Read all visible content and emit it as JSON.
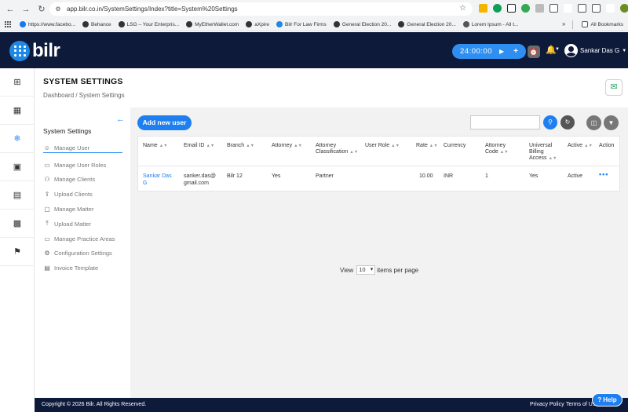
{
  "browser": {
    "url": "app.bilr.co.in/SystemSettings/Index?title=System%20Settings",
    "bookmarks": [
      {
        "label": "https://www.facebo...",
        "color": "#1877f2"
      },
      {
        "label": "Behance",
        "color": "#333333"
      },
      {
        "label": "LSG – Your Enterpris...",
        "color": "#333333"
      },
      {
        "label": "MyEtherWallet.com",
        "color": "#333333"
      },
      {
        "label": "aXpire",
        "color": "#333333"
      },
      {
        "label": "Bilr For Law Firms",
        "color": "#1e88e5"
      },
      {
        "label": "General Election 20...",
        "color": "#333333"
      },
      {
        "label": "General Election 20...",
        "color": "#333333"
      },
      {
        "label": "Lorem Ipsum - All t...",
        "color": "#555555"
      }
    ],
    "all_bookmarks": "All Bookmarks",
    "more": "»"
  },
  "header": {
    "brand": "bilr",
    "timer": "24:00:00",
    "user_name": "Sankar Das G"
  },
  "rail": [
    "plus-square-icon",
    "dashboard-icon",
    "settings-icon",
    "calendar-icon",
    "document-icon",
    "clipboard-icon",
    "presentation-icon"
  ],
  "page": {
    "title": "SYSTEM SETTINGS",
    "breadcrumb": "Dashboard / System Settings"
  },
  "submenu": {
    "title": "System Settings",
    "items": [
      {
        "label": "Manage User",
        "icon": "user-icon",
        "glyph": "☺"
      },
      {
        "label": "Manage User Roles",
        "icon": "roles-icon",
        "glyph": "▭"
      },
      {
        "label": "Manage Clients",
        "icon": "clients-icon",
        "glyph": "⚇"
      },
      {
        "label": "Upload Clients",
        "icon": "upload-clients-icon",
        "glyph": "⇪"
      },
      {
        "label": "Manage Matter",
        "icon": "matter-icon",
        "glyph": "▢"
      },
      {
        "label": "Upload Matter",
        "icon": "upload-matter-icon",
        "glyph": "⤒"
      },
      {
        "label": "Manage Practice Areas",
        "icon": "practice-areas-icon",
        "glyph": "▭"
      },
      {
        "label": "Configuration Settings",
        "icon": "config-gear-icon",
        "glyph": "⚙"
      },
      {
        "label": "Invoice Template",
        "icon": "invoice-icon",
        "glyph": "▤"
      }
    ]
  },
  "toolbar": {
    "add_user": "Add new user",
    "search_placeholder": ""
  },
  "table": {
    "headers": {
      "name": "Name",
      "email": "Email ID",
      "branch": "Branch",
      "attorney": "Attorney",
      "attorney_classification": "Attorney Classification",
      "user_role": "User Role",
      "rate": "Rate",
      "currency": "Currency",
      "attorney_code": "Attorney Code",
      "universal_billing": "Universal Billing Access",
      "active": "Active",
      "action": "Action"
    },
    "rows": [
      {
        "name": "Sankar Das G",
        "email": "sanker.das@ gmail.com",
        "branch": "Bilr 12",
        "attorney": "Yes",
        "attorney_classification": "Partner",
        "user_role": "",
        "rate": "10.00",
        "currency": "INR",
        "attorney_code": "1",
        "universal_billing": "Yes",
        "active": "Active",
        "action": "•••"
      }
    ]
  },
  "pager": {
    "view": "View",
    "page_size": "10",
    "suffix": "items per page"
  },
  "footer": {
    "copyright": "Copyright © 2026 Bilr. All Rights Reserved.",
    "privacy": "Privacy Policy",
    "terms": "Terms of Use",
    "help": "Help"
  }
}
